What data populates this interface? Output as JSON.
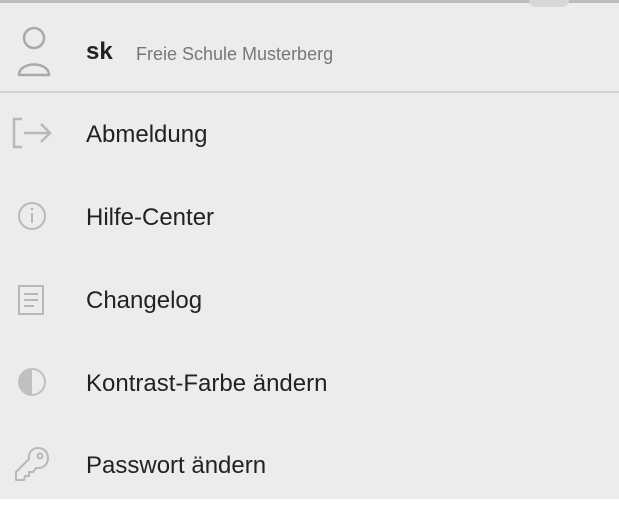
{
  "user": {
    "name": "sk",
    "school": "Freie Schule Musterberg",
    "icon": "user-icon"
  },
  "menu": {
    "items": [
      {
        "label": "Abmeldung",
        "icon": "logout-icon"
      },
      {
        "label": "Hilfe-Center",
        "icon": "info-icon"
      },
      {
        "label": "Changelog",
        "icon": "document-icon"
      },
      {
        "label": "Kontrast-Farbe ändern",
        "icon": "contrast-icon"
      },
      {
        "label": "Passwort ändern",
        "icon": "key-icon"
      }
    ]
  },
  "colors": {
    "background": "#ececec",
    "icon": "#b8b8b8",
    "text": "#222222",
    "subtext": "#777777",
    "divider": "#d4d4d4"
  }
}
